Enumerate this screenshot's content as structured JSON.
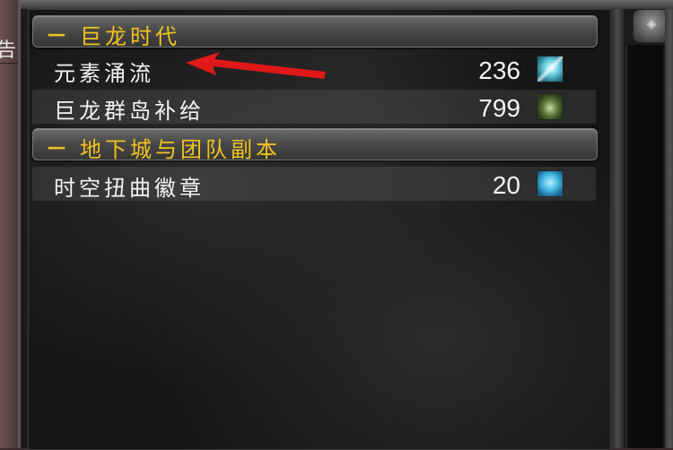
{
  "side_tab": {
    "text": "告"
  },
  "categories": [
    {
      "header": "巨龙时代",
      "toggle": "－",
      "items": [
        {
          "name": "元素涌流",
          "count": "236",
          "icon": "elemental-crystal-icon"
        },
        {
          "name": "巨龙群岛补给",
          "count": "799",
          "icon": "dragon-isles-supplies-icon"
        }
      ]
    },
    {
      "header": "地下城与团队副本",
      "toggle": "－",
      "items": [
        {
          "name": "时空扭曲徽章",
          "count": "20",
          "icon": "timewarped-badge-icon"
        }
      ]
    }
  ],
  "annotation": {
    "type": "red-arrow",
    "color": "#e01818",
    "points_to": "元素涌流"
  },
  "colors": {
    "header_text": "#f2c31f",
    "item_text": "#f4f4f4",
    "panel_bg": "#151515"
  }
}
